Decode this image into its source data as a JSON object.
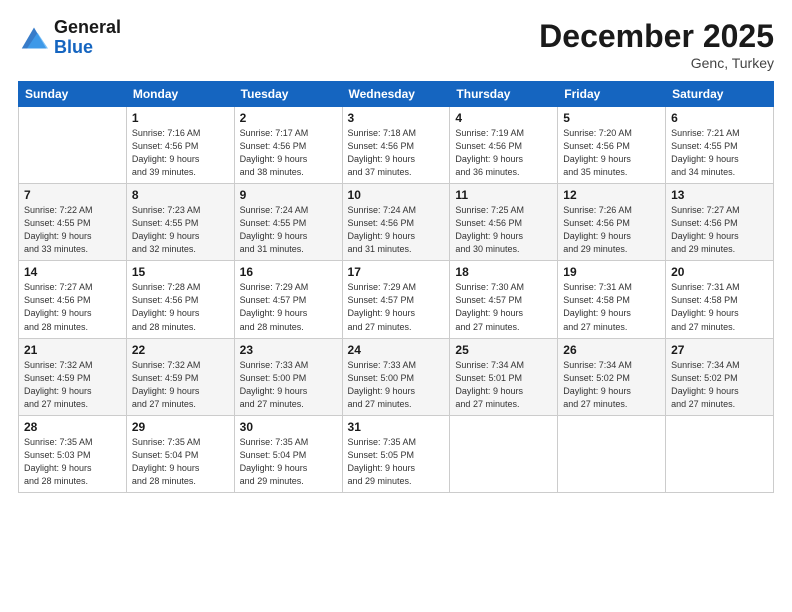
{
  "header": {
    "logo_line1": "General",
    "logo_line2": "Blue",
    "month": "December 2025",
    "location": "Genc, Turkey"
  },
  "days_of_week": [
    "Sunday",
    "Monday",
    "Tuesday",
    "Wednesday",
    "Thursday",
    "Friday",
    "Saturday"
  ],
  "weeks": [
    [
      {
        "day": "",
        "info": ""
      },
      {
        "day": "1",
        "info": "Sunrise: 7:16 AM\nSunset: 4:56 PM\nDaylight: 9 hours\nand 39 minutes."
      },
      {
        "day": "2",
        "info": "Sunrise: 7:17 AM\nSunset: 4:56 PM\nDaylight: 9 hours\nand 38 minutes."
      },
      {
        "day": "3",
        "info": "Sunrise: 7:18 AM\nSunset: 4:56 PM\nDaylight: 9 hours\nand 37 minutes."
      },
      {
        "day": "4",
        "info": "Sunrise: 7:19 AM\nSunset: 4:56 PM\nDaylight: 9 hours\nand 36 minutes."
      },
      {
        "day": "5",
        "info": "Sunrise: 7:20 AM\nSunset: 4:56 PM\nDaylight: 9 hours\nand 35 minutes."
      },
      {
        "day": "6",
        "info": "Sunrise: 7:21 AM\nSunset: 4:55 PM\nDaylight: 9 hours\nand 34 minutes."
      }
    ],
    [
      {
        "day": "7",
        "info": "Sunrise: 7:22 AM\nSunset: 4:55 PM\nDaylight: 9 hours\nand 33 minutes."
      },
      {
        "day": "8",
        "info": "Sunrise: 7:23 AM\nSunset: 4:55 PM\nDaylight: 9 hours\nand 32 minutes."
      },
      {
        "day": "9",
        "info": "Sunrise: 7:24 AM\nSunset: 4:55 PM\nDaylight: 9 hours\nand 31 minutes."
      },
      {
        "day": "10",
        "info": "Sunrise: 7:24 AM\nSunset: 4:56 PM\nDaylight: 9 hours\nand 31 minutes."
      },
      {
        "day": "11",
        "info": "Sunrise: 7:25 AM\nSunset: 4:56 PM\nDaylight: 9 hours\nand 30 minutes."
      },
      {
        "day": "12",
        "info": "Sunrise: 7:26 AM\nSunset: 4:56 PM\nDaylight: 9 hours\nand 29 minutes."
      },
      {
        "day": "13",
        "info": "Sunrise: 7:27 AM\nSunset: 4:56 PM\nDaylight: 9 hours\nand 29 minutes."
      }
    ],
    [
      {
        "day": "14",
        "info": "Sunrise: 7:27 AM\nSunset: 4:56 PM\nDaylight: 9 hours\nand 28 minutes."
      },
      {
        "day": "15",
        "info": "Sunrise: 7:28 AM\nSunset: 4:56 PM\nDaylight: 9 hours\nand 28 minutes."
      },
      {
        "day": "16",
        "info": "Sunrise: 7:29 AM\nSunset: 4:57 PM\nDaylight: 9 hours\nand 28 minutes."
      },
      {
        "day": "17",
        "info": "Sunrise: 7:29 AM\nSunset: 4:57 PM\nDaylight: 9 hours\nand 27 minutes."
      },
      {
        "day": "18",
        "info": "Sunrise: 7:30 AM\nSunset: 4:57 PM\nDaylight: 9 hours\nand 27 minutes."
      },
      {
        "day": "19",
        "info": "Sunrise: 7:31 AM\nSunset: 4:58 PM\nDaylight: 9 hours\nand 27 minutes."
      },
      {
        "day": "20",
        "info": "Sunrise: 7:31 AM\nSunset: 4:58 PM\nDaylight: 9 hours\nand 27 minutes."
      }
    ],
    [
      {
        "day": "21",
        "info": "Sunrise: 7:32 AM\nSunset: 4:59 PM\nDaylight: 9 hours\nand 27 minutes."
      },
      {
        "day": "22",
        "info": "Sunrise: 7:32 AM\nSunset: 4:59 PM\nDaylight: 9 hours\nand 27 minutes."
      },
      {
        "day": "23",
        "info": "Sunrise: 7:33 AM\nSunset: 5:00 PM\nDaylight: 9 hours\nand 27 minutes."
      },
      {
        "day": "24",
        "info": "Sunrise: 7:33 AM\nSunset: 5:00 PM\nDaylight: 9 hours\nand 27 minutes."
      },
      {
        "day": "25",
        "info": "Sunrise: 7:34 AM\nSunset: 5:01 PM\nDaylight: 9 hours\nand 27 minutes."
      },
      {
        "day": "26",
        "info": "Sunrise: 7:34 AM\nSunset: 5:02 PM\nDaylight: 9 hours\nand 27 minutes."
      },
      {
        "day": "27",
        "info": "Sunrise: 7:34 AM\nSunset: 5:02 PM\nDaylight: 9 hours\nand 27 minutes."
      }
    ],
    [
      {
        "day": "28",
        "info": "Sunrise: 7:35 AM\nSunset: 5:03 PM\nDaylight: 9 hours\nand 28 minutes."
      },
      {
        "day": "29",
        "info": "Sunrise: 7:35 AM\nSunset: 5:04 PM\nDaylight: 9 hours\nand 28 minutes."
      },
      {
        "day": "30",
        "info": "Sunrise: 7:35 AM\nSunset: 5:04 PM\nDaylight: 9 hours\nand 29 minutes."
      },
      {
        "day": "31",
        "info": "Sunrise: 7:35 AM\nSunset: 5:05 PM\nDaylight: 9 hours\nand 29 minutes."
      },
      {
        "day": "",
        "info": ""
      },
      {
        "day": "",
        "info": ""
      },
      {
        "day": "",
        "info": ""
      }
    ]
  ]
}
